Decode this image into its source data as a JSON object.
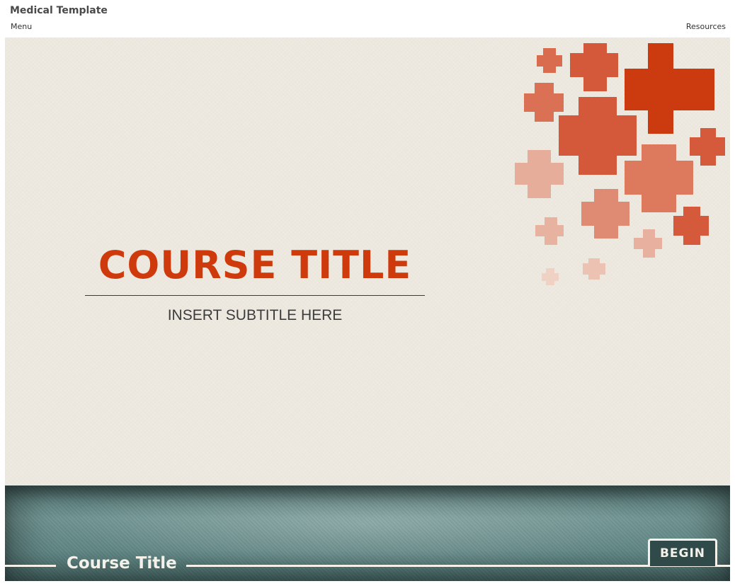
{
  "app": {
    "title": "Medical Template"
  },
  "topnav": {
    "menu_label": "Menu",
    "resources_label": "Resources"
  },
  "slide": {
    "course_title": "COURSE TITLE",
    "subtitle": "INSERT SUBTITLE HERE",
    "decoration_icon": "medical-cross-icon"
  },
  "footer": {
    "course_title": "Course Title",
    "begin_label": "BEGIN"
  },
  "colors": {
    "accent": "#cf3a0d",
    "slide_background": "#efebe1",
    "footer_teal": "#5f8583",
    "button_dark": "#2f4a48",
    "text_light": "#f3f1ea"
  }
}
